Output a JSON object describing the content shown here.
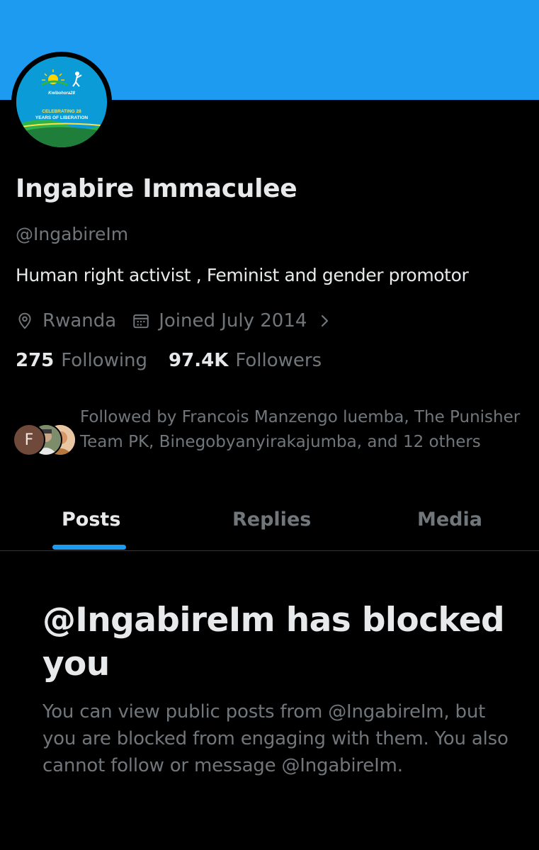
{
  "profile": {
    "banner_color": "#1d9bf0",
    "avatar": {
      "brand": "Kwibohora28",
      "line1": "CELEBRATING 28",
      "line2": "YEARS OF LIBERATION"
    },
    "display_name": "Ingabire Immaculee",
    "handle": "@IngabireIm",
    "bio": "Human right activist , Feminist and gender promotor",
    "location": "Rwanda",
    "location_icon": "location-pin-icon",
    "joined": "Joined July 2014",
    "joined_icon": "calendar-icon",
    "following_count": "275",
    "following_label": "Following",
    "followers_count": "97.4K",
    "followers_label": "Followers",
    "followed_by_initial": "F",
    "followed_by_text": "Followed by Francois Manzengo luemba, The Punisher Team PK, Binegobyanyirakajumba, and 12 others"
  },
  "tabs": [
    {
      "label": "Posts",
      "active": true
    },
    {
      "label": "Replies",
      "active": false
    },
    {
      "label": "Media",
      "active": false
    }
  ],
  "blocked": {
    "title": "@IngabireIm has blocked you",
    "description": "You can view public posts from @IngabireIm, but you are blocked from engaging with them. You also cannot follow or message @IngabireIm."
  },
  "colors": {
    "accent": "#1d9bf0",
    "background": "#000000",
    "text_primary": "#e7e9ea",
    "text_secondary": "#71767b"
  }
}
